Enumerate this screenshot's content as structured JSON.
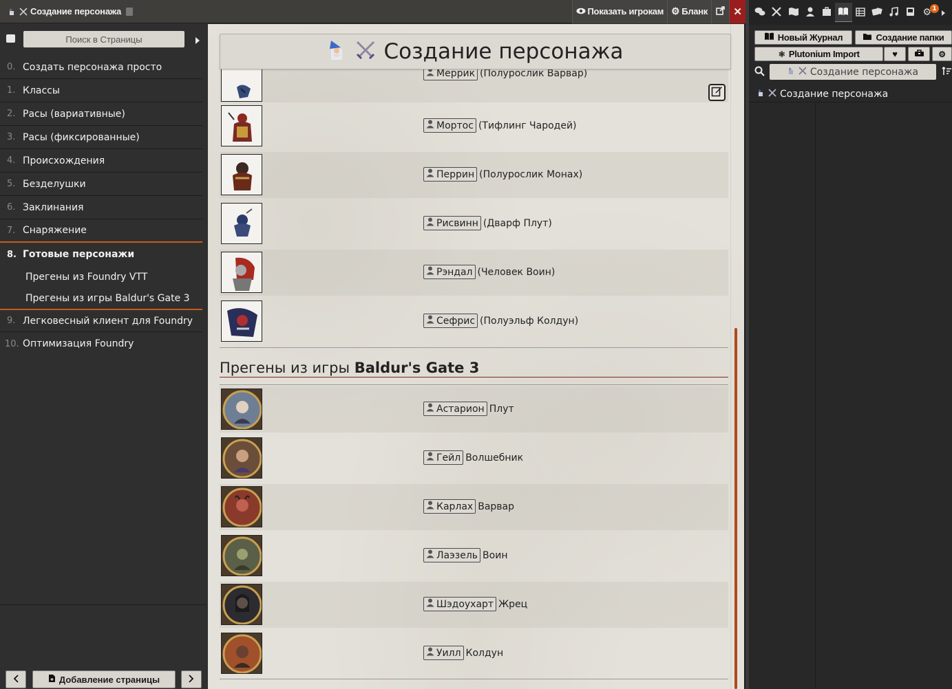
{
  "window": {
    "title": "Создание персонажа",
    "show_players_label": "Показать игрокам",
    "sheet_label": "Бланк"
  },
  "toc": {
    "search_placeholder": "Поиск в Страницы",
    "items": [
      {
        "num": "0.",
        "label": "Создать персонажа просто"
      },
      {
        "num": "1.",
        "label": "Классы"
      },
      {
        "num": "2.",
        "label": "Расы (вариативные)"
      },
      {
        "num": "3.",
        "label": "Расы (фиксированные)"
      },
      {
        "num": "4.",
        "label": "Происхождения"
      },
      {
        "num": "5.",
        "label": "Безделушки"
      },
      {
        "num": "6.",
        "label": "Заклинания"
      },
      {
        "num": "7.",
        "label": "Снаряжение"
      }
    ],
    "active": {
      "num": "8.",
      "label": "Готовые персонажи"
    },
    "subitems": [
      "Прегены из Foundry VTT",
      "Прегены из игры Baldur's Gate 3"
    ],
    "after": [
      {
        "num": "9.",
        "label": "Легковесный клиент для Foundry"
      },
      {
        "num": "10.",
        "label": "Оптимизация Foundry"
      }
    ],
    "add_page_label": "Добавление страницы"
  },
  "page": {
    "title": "Создание персонажа",
    "foundry_chars": [
      {
        "name": "Меррик",
        "desc": "(Полурослик Варвар)"
      },
      {
        "name": "Мортос",
        "desc": "(Тифлинг Чародей)"
      },
      {
        "name": "Перрин",
        "desc": "(Полурослик Монах)"
      },
      {
        "name": "Рисвинн",
        "desc": "(Дварф Плут)"
      },
      {
        "name": "Рэндал",
        "desc": "(Человек Воин)"
      },
      {
        "name": "Сефрис",
        "desc": "(Полуэльф Колдун)"
      }
    ],
    "bg3_heading_prefix": "Прегены из игры ",
    "bg3_heading_bold": "Baldur's Gate 3",
    "bg3_chars": [
      {
        "name": "Астарион",
        "desc": "Плут",
        "color": "#6e7f95"
      },
      {
        "name": "Гейл",
        "desc": "Волшебник",
        "color": "#6a4e3a"
      },
      {
        "name": "Карлах",
        "desc": "Варвар",
        "color": "#8a3a2a"
      },
      {
        "name": "Лаэзель",
        "desc": "Воин",
        "color": "#5a6048"
      },
      {
        "name": "Шэдоухарт",
        "desc": "Жрец",
        "color": "#2c2c30"
      },
      {
        "name": "Уилл",
        "desc": "Колдун",
        "color": "#a0502a"
      }
    ]
  },
  "sidebar": {
    "new_journal_label": "Новый Журнал",
    "new_folder_label": "Создание папки",
    "plutonium_label": "Plutonium Import",
    "search_value": "Создание персонажа",
    "entry_label": "Создание персонажа",
    "notification_count": "1"
  }
}
